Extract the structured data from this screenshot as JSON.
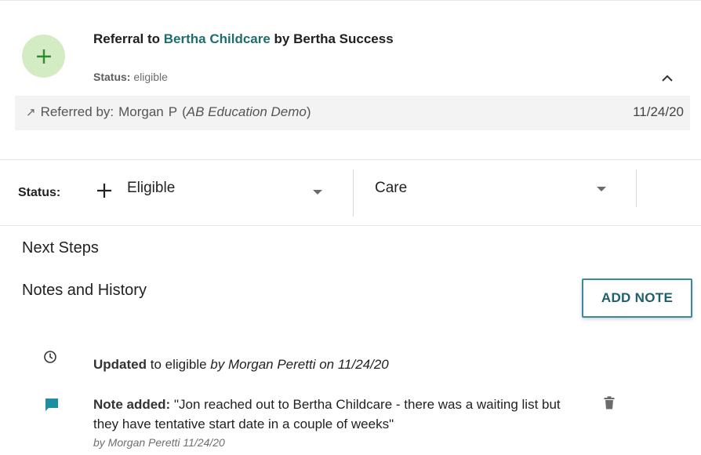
{
  "referral": {
    "title_prefix": "Referral to",
    "provider": "Bertha Childcare",
    "title_by": "by Bertha Success",
    "status_label": "Status:",
    "status_value": "eligible",
    "referred_by_label": "Referred by:",
    "referrer_first": "Morgan",
    "referrer_last": "P",
    "referrer_org": "AB Education Demo",
    "date": "11/24/20"
  },
  "status_bar": {
    "label": "Status:",
    "status_value": "Eligible",
    "category_value": "Care"
  },
  "sections": {
    "next_steps": "Next Steps",
    "notes_history": "Notes and History",
    "add_note_label": "ADD NOTE"
  },
  "history": [
    {
      "icon": "clock-icon",
      "action": "Updated",
      "detail": "to eligible",
      "byline": "by Morgan Peretti on 11/24/20"
    },
    {
      "icon": "comment-icon",
      "action": "Note added:",
      "text": "\"Jon reached out to Bertha Childcare - there was a waiting list but they have tentative start date in a couple of weeks\"",
      "byline": "by Morgan Peretti 11/24/20"
    }
  ],
  "colors": {
    "accent": "#1f6e6e",
    "button_border": "#3a8c9a",
    "plus_circle_bg": "#d4ecc3",
    "plus_green": "#2e8b2e",
    "comment_icon": "#1e8fa3"
  }
}
